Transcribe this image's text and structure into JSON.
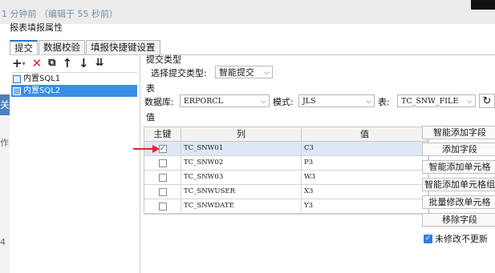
{
  "background": {
    "timestamp_text": "1 分钟前 （编辑于 55 秒前）",
    "left_blue_text": "关",
    "left_text_1": "作",
    "left_text_2": "4"
  },
  "dialog": {
    "title": "报表填报属性",
    "tabs": [
      {
        "label": "提交",
        "active": true
      },
      {
        "label": "数据校验",
        "active": false
      },
      {
        "label": "填报快捷键设置",
        "active": false
      }
    ],
    "toolbar": {
      "add": "+",
      "add_dropdown": "▾",
      "delete": "✕",
      "copy": "⧉",
      "up": "↑",
      "down": "↓",
      "sort": "⇊"
    },
    "sql_items": [
      {
        "label": "内置SQL1",
        "selected": false
      },
      {
        "label": "内置SQL2",
        "selected": true
      }
    ],
    "submit_type": {
      "section_label": "提交类型",
      "select_label": "选择提交类型:",
      "value": "智能提交"
    },
    "table_section": {
      "section_label": "表",
      "db_label": "数据库:",
      "db_value": "ERPORCL",
      "schema_label": "模式:",
      "schema_value": "JLS",
      "table_label": "表:",
      "table_value": "TC_SNW_FILE"
    },
    "value_section_label": "值",
    "grid": {
      "headers": [
        "主键",
        "列",
        "值"
      ],
      "rows": [
        {
          "key": true,
          "column": "TC_SNW01",
          "value": "C3",
          "selected": true
        },
        {
          "key": false,
          "column": "TC_SNW02",
          "value": "P3",
          "selected": false
        },
        {
          "key": false,
          "column": "TC_SNW03",
          "value": "W3",
          "selected": false
        },
        {
          "key": false,
          "column": "TC_SNWUSER",
          "value": "X3",
          "selected": false
        },
        {
          "key": false,
          "column": "TC_SNWDATE",
          "value": "Y3",
          "selected": false
        }
      ]
    },
    "buttons": [
      "智能添加字段",
      "添加字段",
      "智能添加单元格",
      "智能添加单元格组",
      "批量修改单元格",
      "移除字段"
    ],
    "keep_checkbox": {
      "label": "未修改不更新",
      "checked": true
    },
    "check_mark": "✓",
    "refresh_icon": "↻",
    "accent_color": "#2a6fc4",
    "arrow_color": "#e8202a"
  }
}
